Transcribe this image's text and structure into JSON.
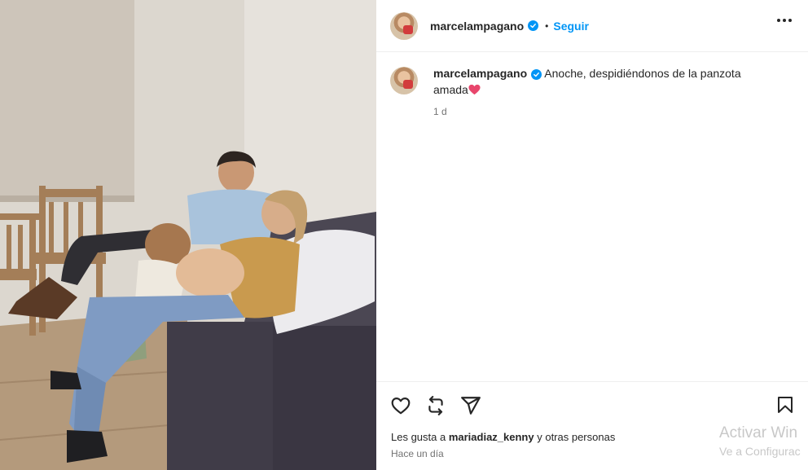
{
  "post": {
    "username": "marcelampagano",
    "follow_label": "Seguir",
    "separator": "•",
    "caption": "Anoche, despidiéndonos de la panzota amada",
    "caption_time": "1 d",
    "likes_prefix": "Les gusta a ",
    "likes_user": "mariadiaz_kenny",
    "likes_suffix": " y otras personas",
    "posted_ago": "Hace un día"
  },
  "watermark": {
    "line1": "Activar Win",
    "line2": "Ve a Configurac"
  },
  "colors": {
    "accent": "#0095f6",
    "text": "#262626",
    "muted": "#737373",
    "heart_emoji": "#e8466c"
  },
  "icons": [
    "verified-icon",
    "more-options-icon",
    "like-heart-icon",
    "repost-icon",
    "share-icon",
    "save-bookmark-icon",
    "heart-emoji-icon"
  ]
}
